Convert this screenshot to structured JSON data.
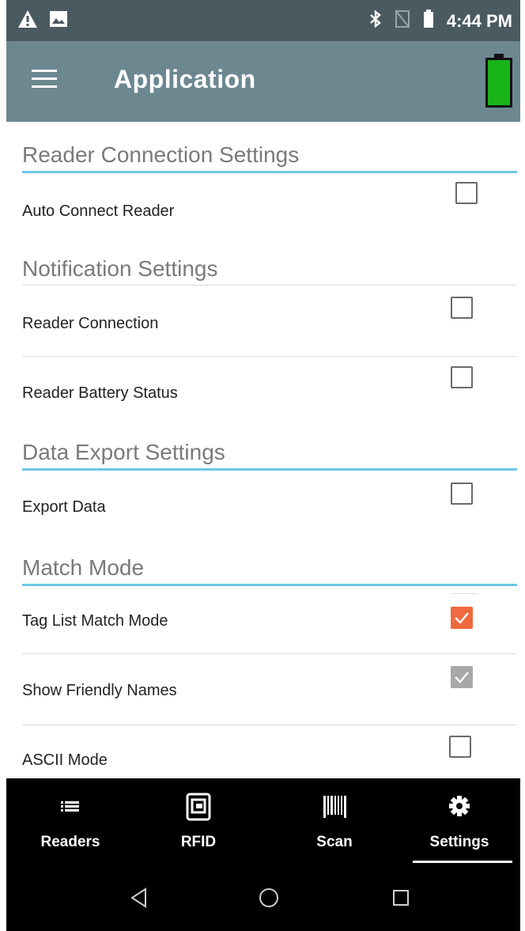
{
  "status_bar": {
    "time": "4:44 PM",
    "left_icons": [
      "warning-icon",
      "image-icon"
    ],
    "right_icons": [
      "bluetooth-icon",
      "no-sim-icon",
      "battery-status-icon"
    ]
  },
  "app_bar": {
    "title": "Application",
    "menu_icon": "hamburger-menu-icon",
    "reader_battery_icon": "reader-battery-icon",
    "reader_battery_color": "#18b418"
  },
  "sections": {
    "reader_connection": {
      "title": "Reader Connection Settings",
      "auto_connect": {
        "label": "Auto Connect Reader",
        "checked": false
      }
    },
    "notification": {
      "title": "Notification Settings",
      "reader_connection": {
        "label": "Reader Connection",
        "checked": false
      },
      "reader_battery": {
        "label": "Reader Battery Status",
        "checked": false
      }
    },
    "data_export": {
      "title": "Data Export Settings",
      "export_data": {
        "label": "Export Data",
        "checked": false
      }
    },
    "match_mode": {
      "title": "Match Mode",
      "tag_list_match": {
        "label": "Tag List Match Mode",
        "checked": true,
        "enabled": true
      },
      "friendly_names": {
        "label": "Show Friendly Names",
        "checked": true,
        "enabled": false
      },
      "ascii_mode": {
        "label": "ASCII Mode",
        "checked": false
      }
    }
  },
  "bottom_nav": {
    "items": [
      {
        "label": "Readers",
        "icon": "list-icon",
        "selected": false
      },
      {
        "label": "RFID",
        "icon": "rfid-tag-icon",
        "selected": false
      },
      {
        "label": "Scan",
        "icon": "barcode-icon",
        "selected": false
      },
      {
        "label": "Settings",
        "icon": "gear-icon",
        "selected": true
      }
    ]
  },
  "system_nav": {
    "icons": [
      "back-icon",
      "home-icon",
      "recents-icon"
    ]
  },
  "colors": {
    "status_bar": "#4a5a60",
    "app_bar": "#6d8791",
    "accent_check": "#ef6a3e",
    "section_rule": "#6ec6e6"
  }
}
